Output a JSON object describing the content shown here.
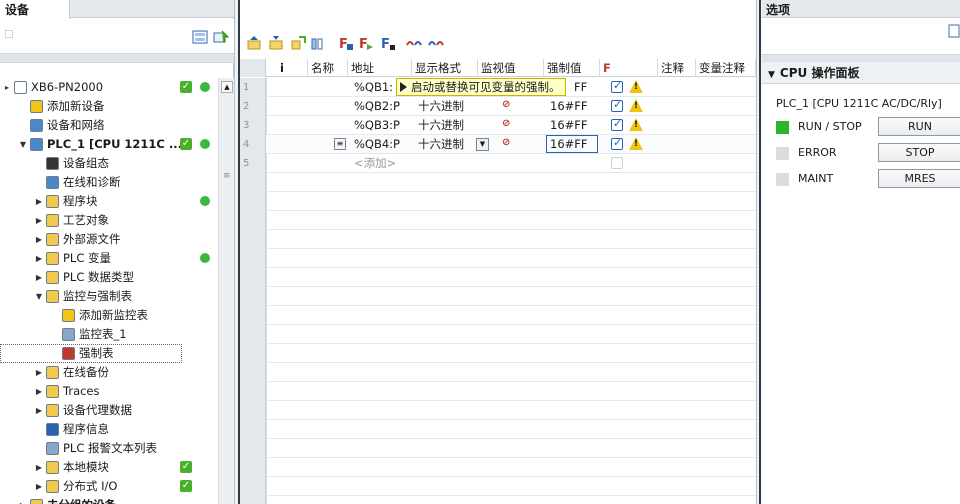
{
  "left": {
    "tab": "设备",
    "tree": [
      {
        "label": "XB6-PN2000",
        "indent": 0,
        "arrow": "▸",
        "icon": "doc",
        "check": true,
        "dot": true
      },
      {
        "label": "添加新设备",
        "indent": 1,
        "icon": "add",
        "check": false,
        "dot": false
      },
      {
        "label": "设备和网络",
        "indent": 1,
        "icon": "net",
        "check": false,
        "dot": false
      },
      {
        "label": "PLC_1 [CPU 1211C ...",
        "indent": 1,
        "arrow": "▼",
        "icon": "plc",
        "check": true,
        "dot": true,
        "bold": true
      },
      {
        "label": "设备组态",
        "indent": 2,
        "icon": "cfg"
      },
      {
        "label": "在线和诊断",
        "indent": 2,
        "icon": "diag"
      },
      {
        "label": "程序块",
        "indent": 2,
        "arrow": "▶",
        "icon": "folder",
        "dot": true
      },
      {
        "label": "工艺对象",
        "indent": 2,
        "arrow": "▶",
        "icon": "folder"
      },
      {
        "label": "外部源文件",
        "indent": 2,
        "arrow": "▶",
        "icon": "folder"
      },
      {
        "label": "PLC 变量",
        "indent": 2,
        "arrow": "▶",
        "icon": "folder",
        "dot": true
      },
      {
        "label": "PLC 数据类型",
        "indent": 2,
        "arrow": "▶",
        "icon": "folder"
      },
      {
        "label": "监控与强制表",
        "indent": 2,
        "arrow": "▼",
        "icon": "folder"
      },
      {
        "label": "添加新监控表",
        "indent": 3,
        "icon": "add"
      },
      {
        "label": "监控表_1",
        "indent": 3,
        "icon": "table"
      },
      {
        "label": "强制表",
        "indent": 3,
        "icon": "force",
        "selected": true
      },
      {
        "label": "在线备份",
        "indent": 2,
        "arrow": "▶",
        "icon": "folder"
      },
      {
        "label": "Traces",
        "indent": 2,
        "arrow": "▶",
        "icon": "folder"
      },
      {
        "label": "设备代理数据",
        "indent": 2,
        "arrow": "▶",
        "icon": "folder"
      },
      {
        "label": "程序信息",
        "indent": 2,
        "icon": "info"
      },
      {
        "label": "PLC 报警文本列表",
        "indent": 2,
        "icon": "text"
      },
      {
        "label": "本地模块",
        "indent": 2,
        "arrow": "▶",
        "icon": "folder",
        "check": true
      },
      {
        "label": "分布式 I/O",
        "indent": 2,
        "arrow": "▶",
        "icon": "folder",
        "check": true
      },
      {
        "label": "未分组的设备",
        "indent": 1,
        "arrow": "▶",
        "icon": "folder",
        "bold": true
      }
    ]
  },
  "table": {
    "headers": [
      "i",
      "名称",
      "地址",
      "显示格式",
      "监视值",
      "强制值",
      "F",
      "注释",
      "变量注释"
    ],
    "rows": [
      {
        "num": "1",
        "addr": "%QB1:",
        "fmt": "",
        "force": "FF",
        "checked": true,
        "warn": true
      },
      {
        "num": "2",
        "addr": "%QB2:P",
        "fmt": "十六进制",
        "force": "16#FF",
        "checked": true,
        "warn": true,
        "mon": true
      },
      {
        "num": "3",
        "addr": "%QB3:P",
        "fmt": "十六进制",
        "force": "16#FF",
        "checked": true,
        "warn": true,
        "mon": true
      },
      {
        "num": "4",
        "addr": "%QB4:P",
        "fmt": "十六进制",
        "force": "16#FF",
        "checked": true,
        "warn": true,
        "mon": true,
        "active": true
      },
      {
        "num": "5",
        "addr": "<添加>",
        "fmt": "",
        "force": "",
        "checked": false,
        "warn": false,
        "placeholder": true
      }
    ],
    "extra_row_nums": [
      "",
      "",
      "",
      "",
      "",
      "",
      "",
      "",
      "",
      "",
      "",
      "",
      "",
      "",
      "",
      "",
      "",
      ""
    ],
    "tooltip": "启动或替换可见变量的强制。"
  },
  "right": {
    "header": "选项",
    "panel_title": "CPU 操作面板",
    "plc_name": "PLC_1 [CPU 1211C AC/DC/Rly]",
    "rows": [
      {
        "label": "RUN / STOP",
        "button": "RUN",
        "led": "#2bb52b"
      },
      {
        "label": "ERROR",
        "button": "STOP",
        "led": "#dcdcdc"
      },
      {
        "label": "MAINT",
        "button": "MRES",
        "led": "#dcdcdc"
      }
    ]
  }
}
